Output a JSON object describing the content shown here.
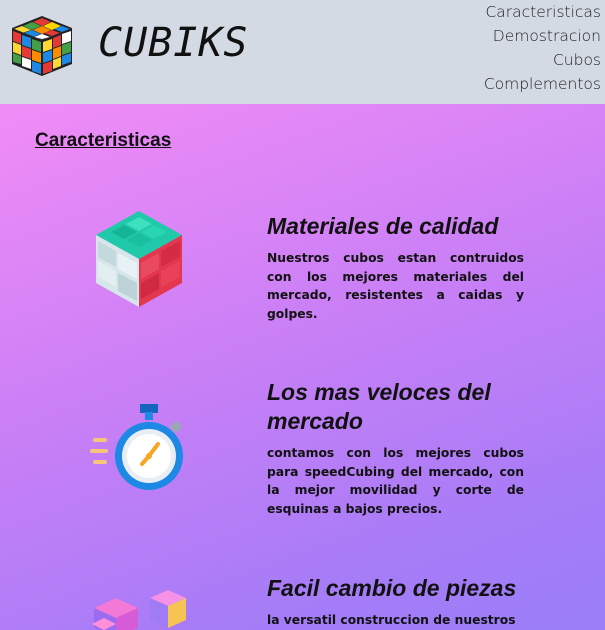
{
  "header": {
    "brand": "CUBIKS",
    "nav": [
      "Caracteristicas",
      "Demostracion",
      "Cubos",
      "Complementos"
    ]
  },
  "main": {
    "section_title": "Caracteristicas",
    "features": [
      {
        "title": "Materiales de calidad",
        "text": "Nuestros cubos estan contruidos con los mejores materiales del mercado, resistentes a caidas y golpes.",
        "icon": "cube-icon"
      },
      {
        "title": "Los mas veloces del mercado",
        "text": "contamos con los mejores cubos para speedCubing del mercado, con la mejor movilidad y corte de esquinas a bajos precios.",
        "icon": "stopwatch-icon"
      },
      {
        "title": "Facil cambio de piezas",
        "text": "la versatil construccion de nuestros",
        "icon": "cube-pieces-icon"
      }
    ]
  }
}
